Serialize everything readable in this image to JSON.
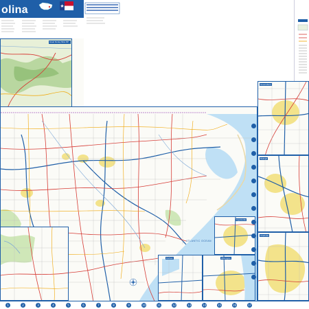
{
  "header": {
    "title_fragment": "olina",
    "state_flag_icon": "north-carolina-flag-icon"
  },
  "inset_labels": {
    "great_smoky": "Great Smoky Mtns NP",
    "ocean": "ATLANTIC OCEAN",
    "raleigh": "Raleigh",
    "wilmington": "Wilmington",
    "charlotte": "Charlotte",
    "greensboro": "Greensboro",
    "fayetteville": "Fayetteville",
    "durham": "Durham"
  },
  "grid_numbers": [
    "1",
    "2",
    "3",
    "4",
    "5",
    "6",
    "7",
    "8",
    "9",
    "10",
    "11",
    "12",
    "13",
    "14",
    "15",
    "16",
    "17"
  ],
  "colors": {
    "border_blue": "#1f5fa8",
    "sea_blue": "#bfe0f5",
    "urban_yellow": "#f3e38b",
    "forest_green": "#cfe7b8",
    "road_red": "#d63b35",
    "land": "#fbfbf7"
  }
}
